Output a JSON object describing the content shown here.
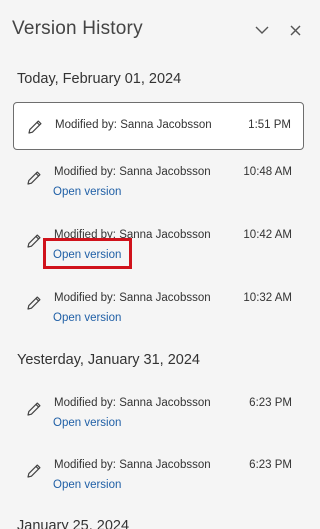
{
  "panel": {
    "title": "Version History",
    "collapse_icon": "chevron-down-icon",
    "close_icon": "close-icon"
  },
  "groups": [
    {
      "label": "Today, February 01, 2024"
    },
    {
      "label": "Yesterday, January 31, 2024"
    },
    {
      "label": "January 25, 2024"
    }
  ],
  "versions": [
    {
      "modified": "Modified by: Sanna Jacobsson",
      "time": "1:51 PM",
      "selected": true
    },
    {
      "modified": "Modified by: Sanna Jacobsson",
      "time": "10:48 AM",
      "open_label": "Open version"
    },
    {
      "modified": "Modified by: Sanna Jacobsson",
      "time": "10:42 AM",
      "open_label": "Open version",
      "highlighted": true
    },
    {
      "modified": "Modified by: Sanna Jacobsson",
      "time": "10:32 AM",
      "open_label": "Open version"
    },
    {
      "modified": "Modified by: Sanna Jacobsson",
      "time": "6:23 PM",
      "open_label": "Open version"
    },
    {
      "modified": "Modified by: Sanna Jacobsson",
      "time": "6:23 PM",
      "open_label": "Open version"
    }
  ],
  "colors": {
    "panel_bg": "#f5f5f5",
    "link": "#1f5fa6",
    "highlight": "#d0121b"
  }
}
